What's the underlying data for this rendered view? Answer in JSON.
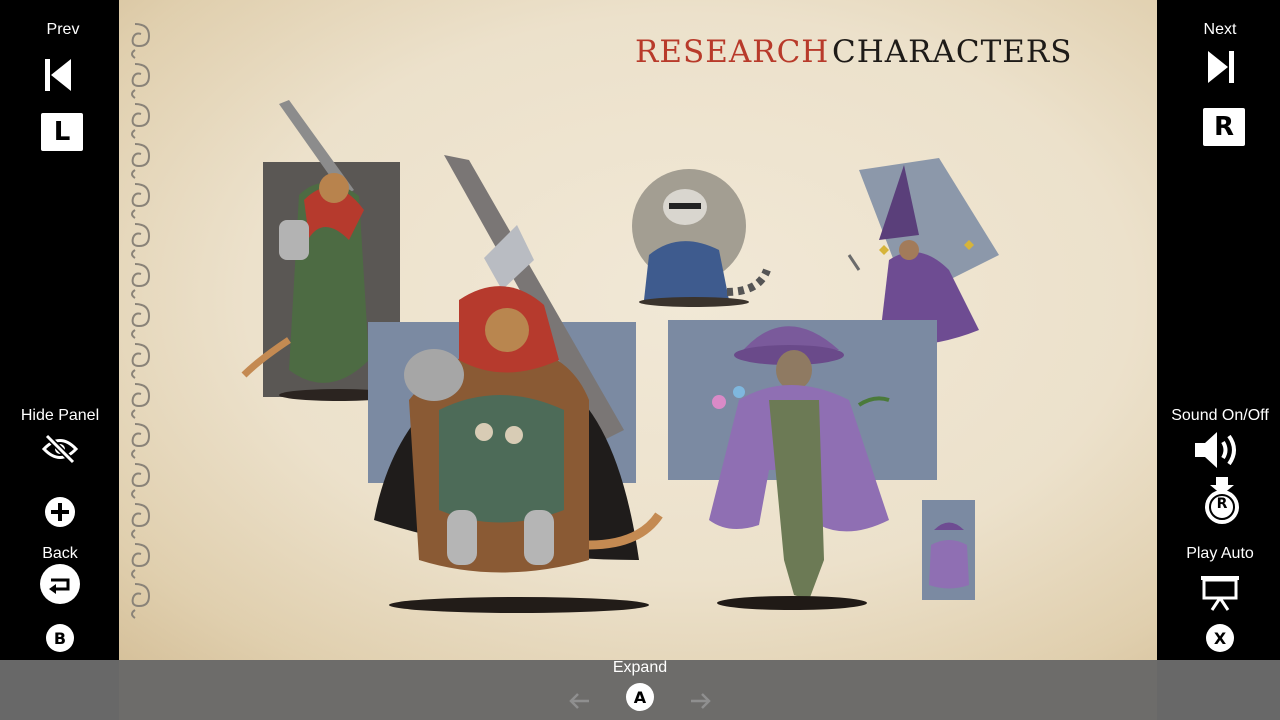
{
  "left_panel": {
    "prev_label": "Prev",
    "prev_key": "L",
    "hide_panel_label": "Hide Panel",
    "back_label": "Back",
    "back_key": "B"
  },
  "right_panel": {
    "next_label": "Next",
    "next_key": "R",
    "sound_label": "Sound On/Off",
    "sound_key": "R",
    "play_auto_label": "Play Auto",
    "play_auto_key": "X"
  },
  "page": {
    "heading_research": "RESEARCH",
    "heading_characters": "CHARACTERS",
    "colors": {
      "research": "#b83a2a",
      "characters": "#1e1b18",
      "slate": "#7b8aa2"
    }
  },
  "bottom_bar": {
    "expand_label": "Expand",
    "expand_key": "A",
    "arrow_left_icon": "arrow-left-icon",
    "arrow_right_icon": "arrow-right-icon"
  }
}
